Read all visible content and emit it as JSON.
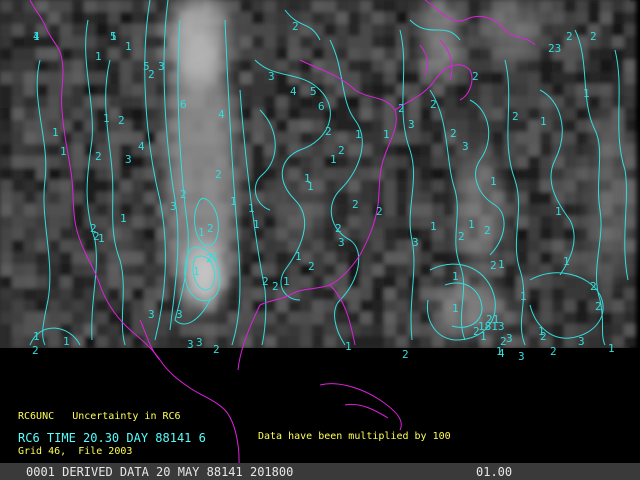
{
  "header": {
    "product_code": "RC6UNC",
    "product_desc": "Uncertainty in RC6",
    "time_line": "RC6 TIME 20.30 DAY 88141 6",
    "grid_line": "Grid 46,  File 2003",
    "scale_note": "Data have been multiplied by 100"
  },
  "status_bar": {
    "left": "0001 DERIVED DATA 20 MAY 88141 201800",
    "right": "01.00"
  },
  "colors": {
    "contour": "#33dddd",
    "coastline": "#dd22dd",
    "header_yellow": "#ffff55",
    "header_cyan": "#55ffff",
    "status_bg": "#3a3a3a"
  },
  "contour_labels": [
    "1",
    "1",
    "1",
    "1",
    "2",
    "3",
    "1",
    "1",
    "2",
    "1",
    "2",
    "3",
    "4",
    "5",
    "6",
    "4",
    "2",
    "1",
    "1",
    "1",
    "3",
    "2",
    "2",
    "1",
    "1",
    "1",
    "2",
    "3",
    "3",
    "3",
    "2",
    "2",
    "1",
    "1",
    "1",
    "2",
    "3",
    "4",
    "5",
    "6",
    "2",
    "1",
    "1",
    "1",
    "2",
    "1",
    "1",
    "3",
    "2",
    "2",
    "2",
    "3",
    "2",
    "2",
    "1",
    "1",
    "2",
    "3",
    "1",
    "2",
    "2",
    "1",
    "1",
    "2",
    "23",
    "1",
    "1",
    "2",
    "2",
    "1",
    "1",
    "2",
    "3",
    "1",
    "2",
    "1",
    "2",
    "3",
    "4",
    "3",
    "2",
    "2",
    "1",
    "2",
    "2",
    "2",
    "1",
    "1",
    "2",
    "3",
    "2",
    "2",
    "1",
    "1",
    "1",
    "1",
    "2",
    "1",
    "2",
    "21",
    "1813",
    "2",
    "3",
    "4",
    "5"
  ]
}
